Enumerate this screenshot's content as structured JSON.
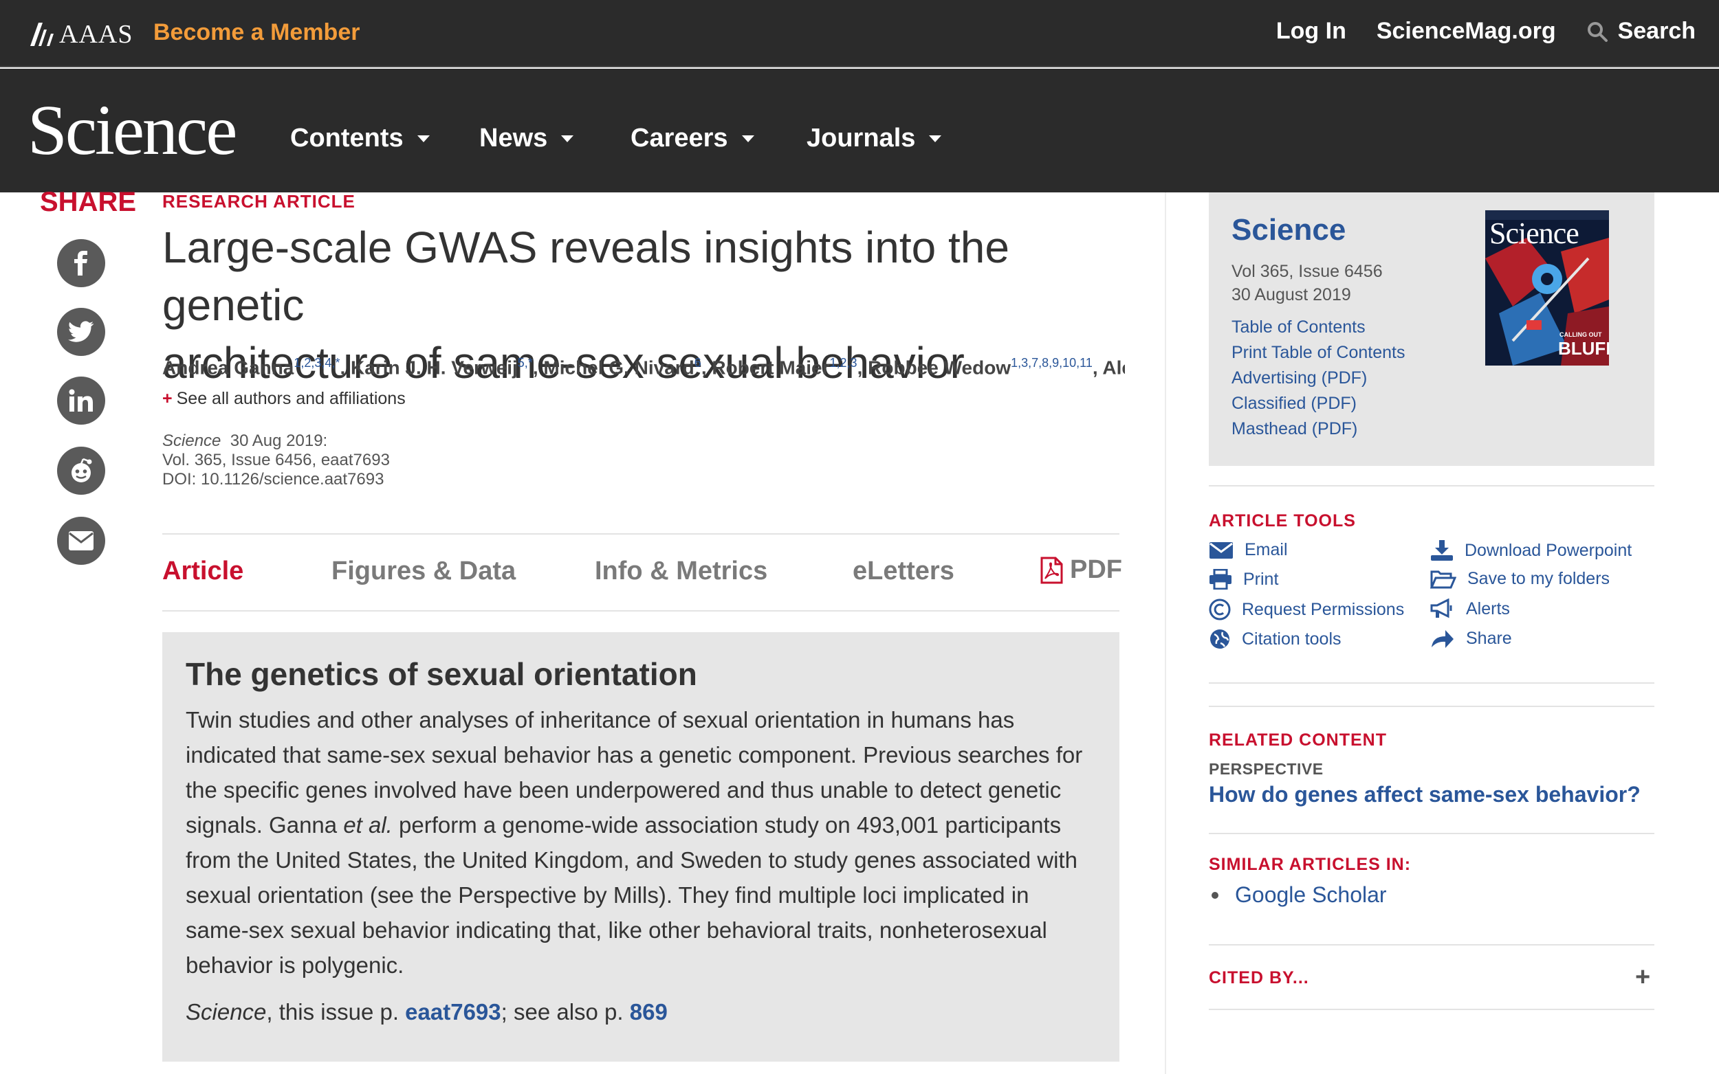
{
  "header": {
    "org": "AAAS",
    "become_member": "Become a Member",
    "login": "Log In",
    "sciencemag": "ScienceMag.org",
    "search": "Search"
  },
  "nav": {
    "logo": "Science",
    "items": [
      "Contents",
      "News",
      "Careers",
      "Journals"
    ]
  },
  "share": {
    "title": "SHARE",
    "icons": [
      "facebook-icon",
      "twitter-icon",
      "linkedin-icon",
      "reddit-icon",
      "email-icon"
    ]
  },
  "article": {
    "type_label": "RESEARCH ARTICLE",
    "title_line1": "Large-scale GWAS reveals insights into the genetic",
    "title_line2": "architecture of same-sex sexual behavior",
    "authors": [
      {
        "name": "Andrea Ganna",
        "sup": "1,2,3,4,*",
        "sep": ", "
      },
      {
        "name": "Karin J. H. Verweij",
        "sup": "5,*",
        "sep": ", "
      },
      {
        "name": "Michel G. Nivard",
        "sup": "6",
        "sep": ", "
      },
      {
        "name": "Robert Maier",
        "sup": "1,2,3",
        "sep": ", "
      },
      {
        "name": "Robbee Wedow",
        "sup": "1,3,7,8,9,10,11",
        "sep": ", "
      },
      {
        "name": "Alexa…",
        "sup": "",
        "sep": ""
      }
    ],
    "see_all": "See all authors and affiliations",
    "see_all_plus": "+",
    "citation_journal": "Science",
    "citation_date": "30 Aug 2019:",
    "citation_vol": "Vol. 365, Issue 6456, eaat7693",
    "citation_doi": "DOI: 10.1126/science.aat7693"
  },
  "tabs": {
    "article": "Article",
    "figures": "Figures & Data",
    "info": "Info & Metrics",
    "eletters": "eLetters",
    "pdf": "PDF"
  },
  "abstract": {
    "title": "The genetics of sexual orientation",
    "body_before_etal": "Twin studies and other analyses of inheritance of sexual orientation in humans has indicated that same-sex sexual behavior has a genetic component. Previous searches for the specific genes involved have been underpowered and thus unable to detect genetic signals. Ganna ",
    "etal": "et al.",
    "body_after_etal": " perform a genome-wide association study on 493,001 participants from the United States, the United Kingdom, and Sweden to study genes associated with sexual orientation (see the Perspective by Mills). They find multiple loci implicated in same-sex sexual behavior indicating that, like other behavioral traits, nonheterosexual behavior is polygenic.",
    "cite_journal": "Science",
    "cite_mid": ", this issue p. ",
    "cite_link1": "eaat7693",
    "cite_mid2": "; see also p. ",
    "cite_link2": "869"
  },
  "sidebar": {
    "issue_title": "Science",
    "vol": "Vol 365, Issue 6456",
    "date": "30 August 2019",
    "issue_links": [
      "Table of Contents",
      "Print Table of Contents",
      "Advertising (PDF)",
      "Classified (PDF)",
      "Masthead (PDF)"
    ],
    "cover": {
      "masthead": "Science",
      "headline_small": "CALLING OUT",
      "headline": "BLUFF"
    },
    "tools_title": "ARTICLE TOOLS",
    "tools": {
      "email": "Email",
      "print": "Print",
      "permissions": "Request Permissions",
      "citation": "Citation tools",
      "powerpoint": "Download Powerpoint",
      "folders": "Save to my folders",
      "alerts": "Alerts",
      "share": "Share"
    },
    "related_title": "RELATED CONTENT",
    "perspective_label": "PERSPECTIVE",
    "perspective_link": "How do genes affect same-sex behavior?",
    "similar_title": "SIMILAR ARTICLES IN:",
    "similar_item": "Google Scholar",
    "cited_title": "CITED BY...",
    "cited_toggle": "+"
  },
  "colors": {
    "brand_red": "#c8102e",
    "link_blue": "#2a5699",
    "header_bg": "#2b2b2b",
    "member_orange": "#f39c3a"
  }
}
